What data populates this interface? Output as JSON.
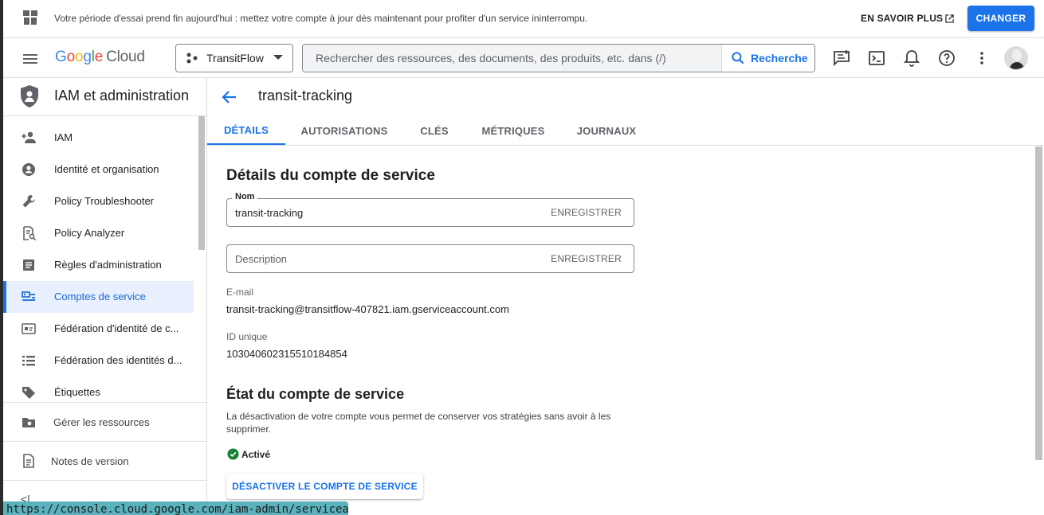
{
  "banner": {
    "text": "Votre période d'essai prend fin aujourd'hui : mettez votre compte à jour dès maintenant pour profiter d'un service ininterrompu.",
    "learn_more": "EN SAVOIR PLUS",
    "upgrade": "CHANGER"
  },
  "header": {
    "logo_google": [
      "G",
      "o",
      "o",
      "g",
      "l",
      "e"
    ],
    "logo_cloud": "Cloud",
    "project": "TransitFlow",
    "search_placeholder": "Rechercher des ressources, des documents, des produits, etc. dans (/)",
    "search_button": "Recherche",
    "icons": [
      "feedback-icon",
      "cloud-shell-icon",
      "notifications-icon",
      "help-icon",
      "more-vert-icon"
    ]
  },
  "sidebar": {
    "title": "IAM et administration",
    "items": [
      {
        "label": "IAM",
        "icon": "person-add-icon"
      },
      {
        "label": "Identité et organisation",
        "icon": "account-circle-icon"
      },
      {
        "label": "Policy Troubleshooter",
        "icon": "wrench-icon"
      },
      {
        "label": "Policy Analyzer",
        "icon": "policy-analyzer-icon"
      },
      {
        "label": "Règles d'administration",
        "icon": "list-doc-icon"
      },
      {
        "label": "Comptes de service",
        "icon": "service-account-icon"
      },
      {
        "label": "Fédération d'identité de c...",
        "icon": "id-card-icon"
      },
      {
        "label": "Fédération des identités d...",
        "icon": "list-icon"
      },
      {
        "label": "Étiquettes",
        "icon": "label-icon"
      }
    ],
    "manage_resources": "Gérer les ressources",
    "release_notes": "Notes de version",
    "collapse": "<|"
  },
  "main": {
    "title": "transit-tracking",
    "tabs": [
      "DÉTAILS",
      "AUTORISATIONS",
      "CLÉS",
      "MÉTRIQUES",
      "JOURNAUX"
    ],
    "active_tab": "DÉTAILS",
    "details_title": "Détails du compte de service",
    "name_label": "Nom",
    "name_value": "transit-tracking",
    "save_label": "ENREGISTRER",
    "description_placeholder": "Description",
    "email_label": "E-mail",
    "email_value": "transit-tracking@transitflow-407821.iam.gserviceaccount.com",
    "unique_id_label": "ID unique",
    "unique_id_value": "103040602315510184854",
    "state_title": "État du compte de service",
    "state_description": "La désactivation de votre compte vous permet de conserver vos stratégies sans avoir à les supprimer.",
    "status": "Activé",
    "disable_button": "DÉSACTIVER LE COMPTE DE SERVICE"
  },
  "status_url": "https://console.cloud.google.com/iam-admin/serviceaccou...",
  "colors": {
    "accent": "#1a73e8",
    "active_bg": "#e8f0fe",
    "success": "#188038"
  }
}
